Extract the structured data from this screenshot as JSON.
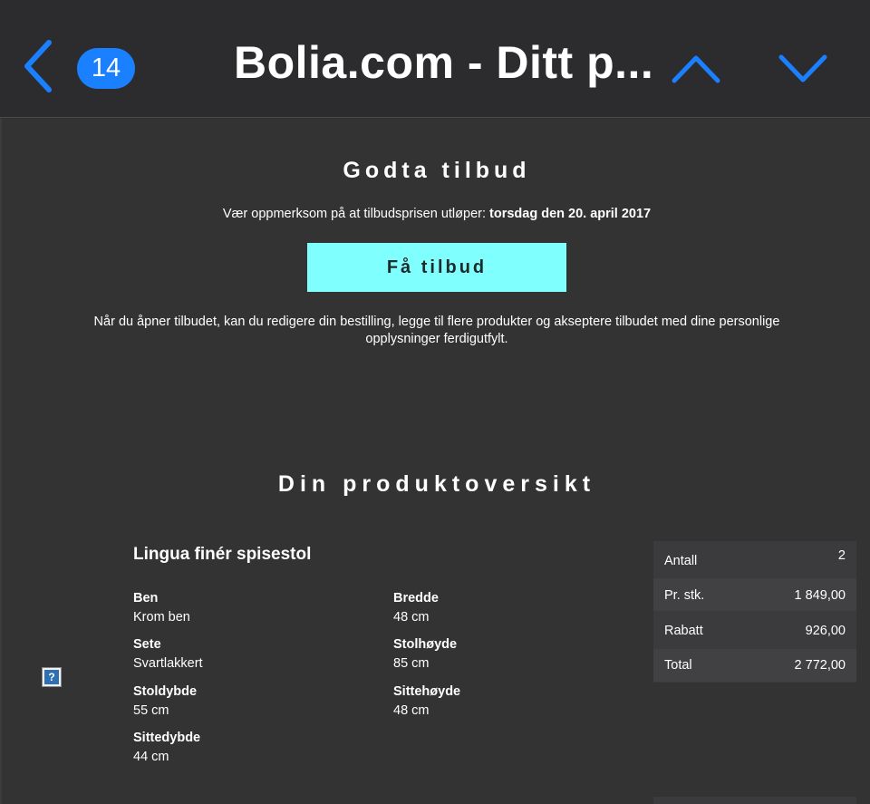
{
  "nav": {
    "badge_count": "14",
    "title": "Bolia.com - Ditt p..."
  },
  "offer": {
    "heading": "Godta tilbud",
    "expiry_prefix": "Vær oppmerksom på at tilbudsprisen utløper: ",
    "expiry_date": "torsdag den 20. april 2017",
    "cta_label": "Få tilbud",
    "note": "Når du åpner tilbudet, kan du redigere din bestilling, legge til flere produkter og akseptere tilbudet med dine personlige opplysninger ferdigutfylt."
  },
  "overview": {
    "heading": "Din produktoversikt",
    "placeholder_glyph": "?",
    "product": {
      "name": "Lingua finér spisestol",
      "attributes": [
        {
          "label": "Ben",
          "value": "Krom ben"
        },
        {
          "label": "Bredde",
          "value": "48 cm"
        },
        {
          "label": "Sete",
          "value": "Svartlakkert"
        },
        {
          "label": "Stolhøyde",
          "value": "85 cm"
        },
        {
          "label": "Stoldybde",
          "value": "55 cm"
        },
        {
          "label": "Sittehøyde",
          "value": "48 cm"
        },
        {
          "label": "Sittedybde",
          "value": "44 cm"
        }
      ]
    },
    "summary": [
      {
        "label": "Antall",
        "value": "2"
      },
      {
        "label": "Pr. stk.",
        "value": "1 849,00"
      },
      {
        "label": "Rabatt",
        "value": "926,00"
      },
      {
        "label": "Total",
        "value": "2 772,00"
      }
    ]
  },
  "colors": {
    "accent": "#1a80ff",
    "cta_background": "#80ffff",
    "background": "#333334"
  }
}
